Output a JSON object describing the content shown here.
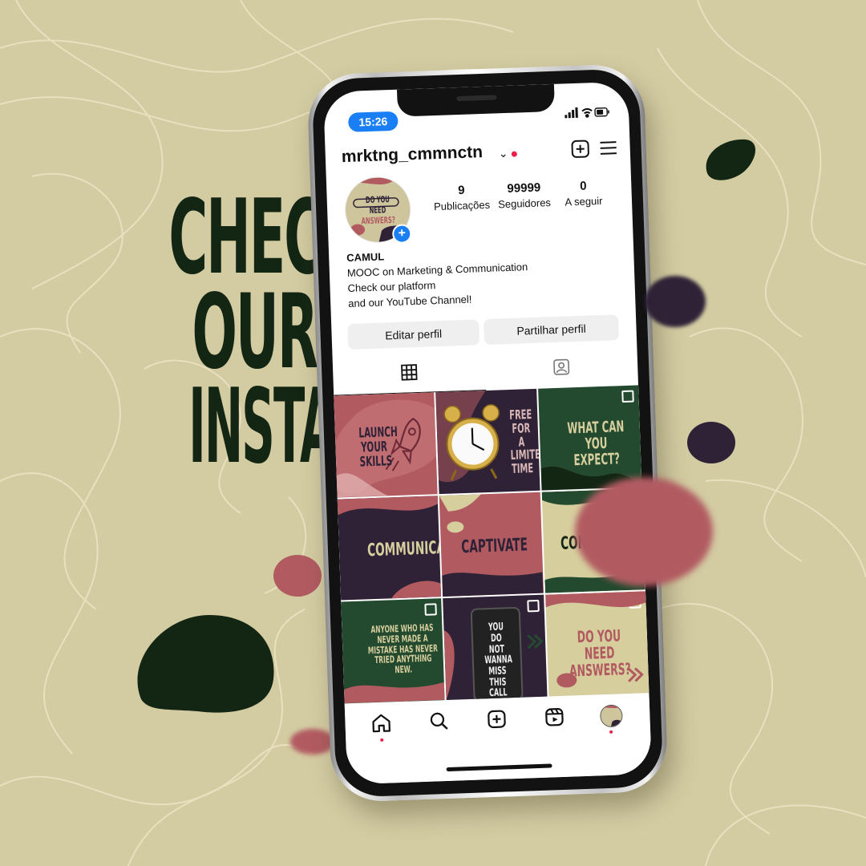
{
  "poster": {
    "headline": [
      "CHECK",
      "OUR",
      "INSTAGRAM"
    ]
  },
  "status_bar": {
    "time": "15:26"
  },
  "profile": {
    "username": "mrktng_cmmnctn",
    "avatar_text": [
      "DO YOU",
      "NEED",
      "ANSWERS?"
    ],
    "stats": [
      {
        "value": "9",
        "label": "Publicações"
      },
      {
        "value": "99999",
        "label": "Seguidores"
      },
      {
        "value": "0",
        "label": "A seguir"
      }
    ],
    "bio": {
      "name": "CAMUL",
      "lines": [
        "MOOC on Marketing & Communication",
        "Check our platform",
        "and our YouTube Channel!"
      ]
    },
    "buttons": {
      "edit": "Editar perfil",
      "share": "Partilhar perfil"
    }
  },
  "posts": [
    {
      "text": "LAUNCH YOUR SKILLS"
    },
    {
      "text": "FREE FOR A LIMITED TIME"
    },
    {
      "text": "WHAT CAN YOU EXPECT?"
    },
    {
      "text": "COMMUNICATE"
    },
    {
      "text": "CAPTIVATE"
    },
    {
      "text": "CONVE"
    },
    {
      "text": "ANYONE WHO HAS NEVER MADE A MISTAKE HAS NEVER TRIED ANYTHING NEW."
    },
    {
      "text": "YOU DO NOT WANNA MISS THIS CALL"
    },
    {
      "text": "DO YOU NEED ANSWERS?"
    }
  ],
  "colors": {
    "background": "#d3cba2",
    "dark_green": "#132614",
    "rose": "#b15b61",
    "plum": "#2f2237",
    "forest": "#234a2e",
    "cream": "#d7ce9e",
    "ig_blue": "#1a7ff4",
    "ig_red": "#ef1d4b"
  },
  "icons": {
    "header": [
      "new-post-icon",
      "menu-icon"
    ],
    "tabs": [
      "grid-icon",
      "tagged-icon"
    ],
    "nav": [
      "home-icon",
      "search-icon",
      "create-icon",
      "reels-icon",
      "profile-icon"
    ]
  }
}
